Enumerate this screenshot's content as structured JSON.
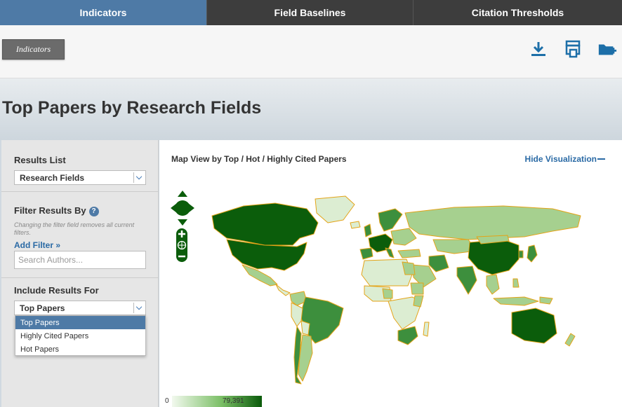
{
  "tabs": [
    {
      "label": "Indicators",
      "active": true
    },
    {
      "label": "Field Baselines",
      "active": false
    },
    {
      "label": "Citation Thresholds",
      "active": false
    }
  ],
  "toolbar": {
    "breadcrumb": "Indicators",
    "icons": [
      "download-icon",
      "print-icon",
      "add-folder-icon"
    ],
    "icon_color": "#1d6fa8"
  },
  "page_title": "Top Papers by Research Fields",
  "left_panel": {
    "results_list": {
      "title": "Results List",
      "selected": "Research Fields"
    },
    "filter": {
      "title": "Filter Results By",
      "note": "Changing the filter field removes all current filters.",
      "add_filter": "Add Filter »",
      "search_placeholder": "Search Authors..."
    },
    "include": {
      "title": "Include Results For",
      "selected": "Top Papers",
      "options": [
        "Top Papers",
        "Highly Cited Papers",
        "Hot Papers"
      ]
    }
  },
  "visualization": {
    "title": "Map View by Top / Hot / Highly Cited Papers",
    "hide_label": "Hide Visualization",
    "legend": {
      "min": "0",
      "max": "79,391"
    },
    "colors": {
      "accent": "#4e7aa6",
      "link": "#2a6aa5",
      "map_dark": "#0b5d0b",
      "map_mid": "#3d8f3d",
      "map_light": "#a6d08f",
      "map_pale": "#dcedd2",
      "border": "#e4a317"
    }
  }
}
